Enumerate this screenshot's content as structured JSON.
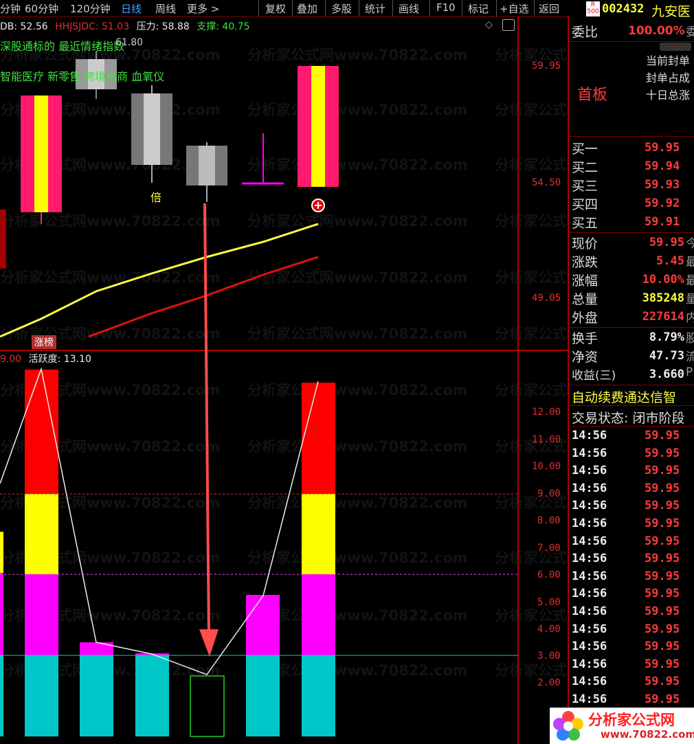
{
  "toolbar": {
    "items": [
      "分钟",
      "60分钟",
      "120分钟",
      "日线",
      "周线",
      "更多 >"
    ],
    "right_items": [
      "复权",
      "叠加",
      "多股",
      "统计",
      "画线",
      "F10",
      "标记",
      "+自选",
      "返回"
    ]
  },
  "indicator_line": {
    "db_label": "DB: 52.56",
    "hhjsjdc_label": "HHJSJDC: 51.03",
    "pressure": "压力: 58.88",
    "support": "支撑: 40.75"
  },
  "news_text": "深股通标的 最近情绪指数",
  "overlay_value": "61.80",
  "concepts": "智能医疗 新零售 跨境电商 血氧仪",
  "candle_marker": "倍",
  "limit_up_tag": "涨榜",
  "price_axis": [
    "59.95",
    "54.50",
    "49.05"
  ],
  "sub_header": {
    "prev": "9.00",
    "activity": "活跃度: 13.10"
  },
  "sub_axis": [
    "12.00",
    "11.00",
    "10.00",
    "9.00",
    "8.00",
    "7.00",
    "6.00",
    "5.00",
    "4.00",
    "3.00",
    "2.00"
  ],
  "watermark": "分析家公式网www.70822.com",
  "right_panel": {
    "badge_r": "R",
    "badge_num": "500",
    "code": "002432",
    "name": "九安医",
    "weibi_label": "委比",
    "weibi_value": "100.00%",
    "weibi_suffix": "委",
    "first_board": "首板",
    "seal_lines": [
      "当前封单",
      "封单占成",
      "十日总涨"
    ],
    "bids": [
      {
        "label": "买一",
        "price": "59.95"
      },
      {
        "label": "买二",
        "price": "59.94"
      },
      {
        "label": "买三",
        "price": "59.93"
      },
      {
        "label": "买四",
        "price": "59.92"
      },
      {
        "label": "买五",
        "price": "59.91"
      }
    ],
    "stats": [
      {
        "label": "现价",
        "value": "59.95",
        "suffix": "今",
        "color": "#ff3b3b"
      },
      {
        "label": "涨跌",
        "value": "5.45",
        "suffix": "最",
        "color": "#ff3b3b"
      },
      {
        "label": "涨幅",
        "value": "10.00%",
        "suffix": "最",
        "color": "#ff3b3b"
      },
      {
        "label": "总量",
        "value": "385248",
        "suffix": "量",
        "color": "#ffff40"
      },
      {
        "label": "外盘",
        "value": "227614",
        "suffix": "内",
        "color": "#ff3b3b"
      }
    ],
    "stats2": [
      {
        "label": "换手",
        "value": "8.79%",
        "suffix": "股"
      },
      {
        "label": "净资",
        "value": "47.73",
        "suffix": "流"
      },
      {
        "label": "收益(三)",
        "value": "3.660",
        "suffix": "P"
      }
    ],
    "promo": "自动续费通达信智",
    "trade_status": "交易状态: 闭市阶段",
    "ticks": [
      {
        "time": "14:56",
        "price": "59.95"
      },
      {
        "time": "14:56",
        "price": "59.95"
      },
      {
        "time": "14:56",
        "price": "59.95"
      },
      {
        "time": "14:56",
        "price": "59.95"
      },
      {
        "time": "14:56",
        "price": "59.95"
      },
      {
        "time": "14:56",
        "price": "59.95"
      },
      {
        "time": "14:56",
        "price": "59.95"
      },
      {
        "time": "14:56",
        "price": "59.95"
      },
      {
        "time": "14:56",
        "price": "59.95"
      },
      {
        "time": "14:56",
        "price": "59.95"
      },
      {
        "time": "14:56",
        "price": "59.95"
      },
      {
        "time": "14:56",
        "price": "59.95"
      },
      {
        "time": "14:56",
        "price": "59.95"
      },
      {
        "time": "14:56",
        "price": "59.95"
      },
      {
        "time": "14:56",
        "price": "59.95"
      },
      {
        "time": "14:56",
        "price": "59.95"
      }
    ]
  },
  "logo": {
    "title": "分析家公式网",
    "url": "www.70822.com"
  },
  "colors": {
    "up": "#ff1a6e",
    "yellow": "#ffff00",
    "red": "#ff0000",
    "magenta": "#ff00ff",
    "cyan": "#00c8c8",
    "green_text": "#40e040",
    "axis": "#e03030"
  }
}
